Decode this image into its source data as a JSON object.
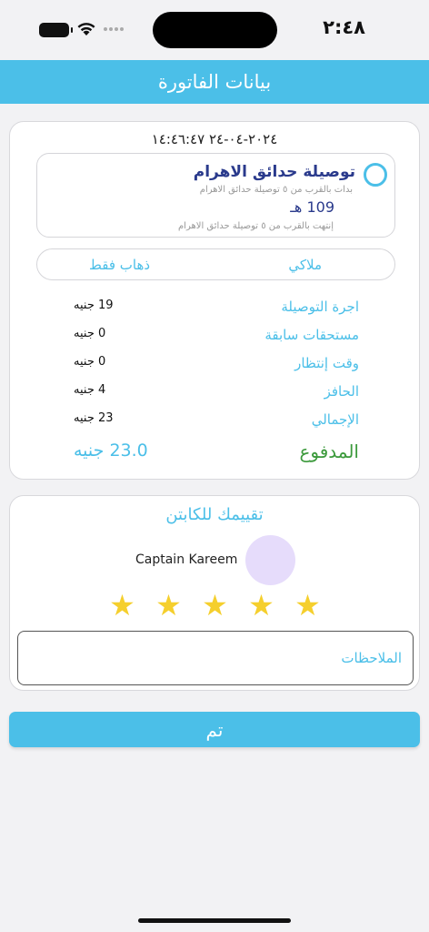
{
  "status_bar": {
    "time": "٢:٤٨",
    "icons": [
      "battery-icon",
      "wifi-icon",
      "signal-icon"
    ]
  },
  "header": {
    "title": "بيانات الفاتورة"
  },
  "invoice": {
    "date": "٢٠٢٤-٠٤-٢٤ ١٤:٤٦:٤٧",
    "trip": {
      "name": "توصيلة حدائق الاهرام",
      "start_text": "بدات بالقرب من ٥ توصيلة حدائق الاهرام",
      "price": "109 هـ",
      "end_text": "إنتهت بالقرب من ٥ توصيلة حدائق الاهرام"
    },
    "trip_type": {
      "right": "ملاكي",
      "left": "ذهاب فقط"
    },
    "rows": [
      {
        "label": "اجرة التوصيلة",
        "value": "19 جنيه"
      },
      {
        "label": "مستحقات سابقة",
        "value": "0 جنيه"
      },
      {
        "label": "وقت إنتظار",
        "value": "0 جنيه"
      },
      {
        "label": "الحافز",
        "value": "4 جنيه"
      },
      {
        "label": "الإجمالي",
        "value": "23 جنيه"
      }
    ],
    "paid": {
      "label": "المدفوع",
      "value": "23.0 جنيه"
    }
  },
  "rating": {
    "title": "تقييمك للكابتن",
    "captain_name": "Captain Kareem",
    "stars": 5,
    "max_stars": 5,
    "notes_placeholder": "الملاحظات"
  },
  "done_button": {
    "label": "تم"
  },
  "colors": {
    "accent": "#4bbfe8",
    "trip_text": "#2a3a8c",
    "paid_green": "#3c9a3c",
    "star": "#f5cf2d",
    "avatar": "#e6dcfb"
  }
}
